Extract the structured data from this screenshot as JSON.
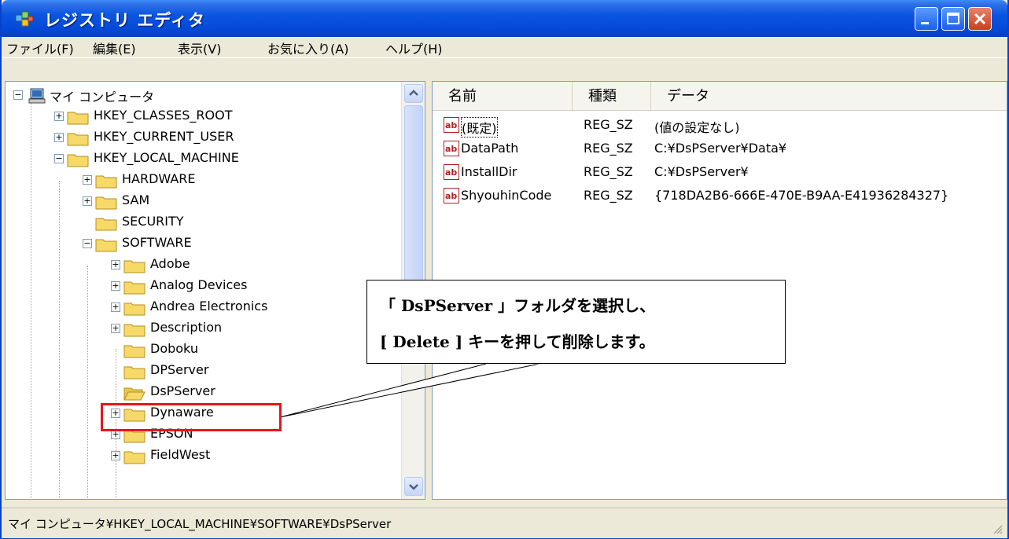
{
  "window": {
    "title": "レジストリ エディタ"
  },
  "menu": [
    "ファイル(F)",
    "編集(E)",
    "表示(V)",
    "お気に入り(A)",
    "ヘルプ(H)"
  ],
  "tree": {
    "root": "マイ コンピュータ",
    "hives": [
      "HKEY_CLASSES_ROOT",
      "HKEY_CURRENT_USER",
      "HKEY_LOCAL_MACHINE"
    ],
    "hklm_children": [
      "HARDWARE",
      "SAM",
      "SECURITY",
      "SOFTWARE"
    ],
    "software_children": [
      "Adobe",
      "Analog Devices",
      "Andrea Electronics",
      "Description",
      "Doboku",
      "DPServer",
      "DsPServer",
      "Dynaware",
      "EPSON",
      "FieldWest"
    ],
    "selected": "DsPServer"
  },
  "list": {
    "headers": [
      "名前",
      "種類",
      "データ"
    ],
    "rows": [
      {
        "name": "(既定)",
        "type": "REG_SZ",
        "data": "(値の設定なし)"
      },
      {
        "name": "DataPath",
        "type": "REG_SZ",
        "data": "C:¥DsPServer¥Data¥"
      },
      {
        "name": "InstallDir",
        "type": "REG_SZ",
        "data": "C:¥DsPServer¥"
      },
      {
        "name": "ShyouhinCode",
        "type": "REG_SZ",
        "data": "{718DA2B6-666E-470E-B9AA-E41936284327}"
      }
    ]
  },
  "status": "マイ コンピュータ¥HKEY_LOCAL_MACHINE¥SOFTWARE¥DsPServer",
  "callout": {
    "line1": "「 DsPServer 」フォルダを選択し、",
    "line2": "[ Delete ] キーを押して削除します。"
  },
  "colors": {
    "titlebar": "#0548d8",
    "highlight": "#e8141c",
    "folder": "#f6d969"
  }
}
